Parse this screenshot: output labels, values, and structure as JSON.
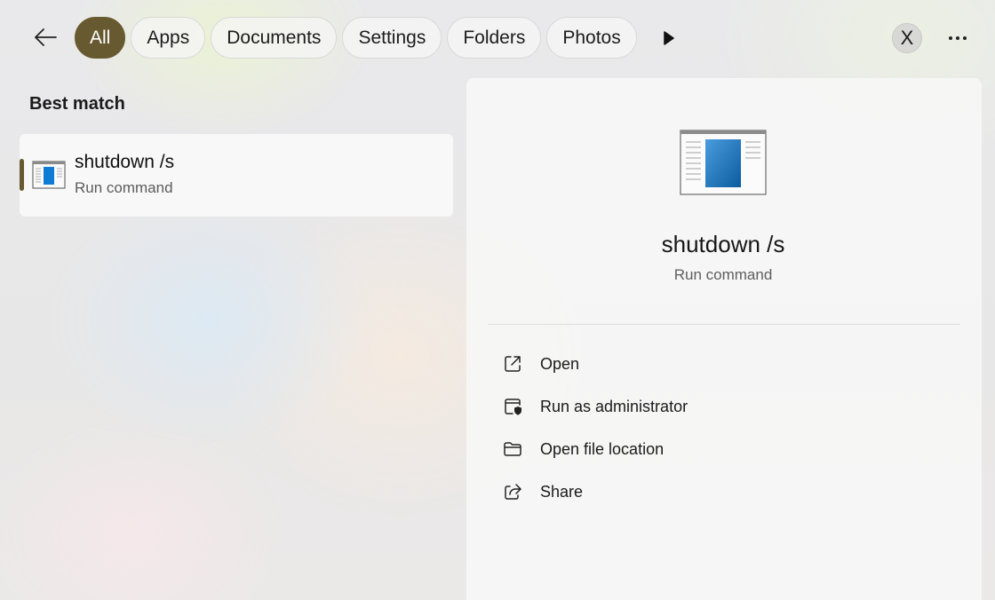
{
  "filters": {
    "items": [
      {
        "label": "All",
        "active": true
      },
      {
        "label": "Apps",
        "active": false
      },
      {
        "label": "Documents",
        "active": false
      },
      {
        "label": "Settings",
        "active": false
      },
      {
        "label": "Folders",
        "active": false
      },
      {
        "label": "Photos",
        "active": false
      }
    ]
  },
  "user": {
    "initial": "X"
  },
  "results": {
    "section_title": "Best match",
    "best_match": {
      "name": "shutdown /s",
      "kind": "Run command"
    }
  },
  "detail": {
    "name": "shutdown /s",
    "kind": "Run command",
    "actions": [
      {
        "label": "Open",
        "icon": "open-external-icon"
      },
      {
        "label": "Run as administrator",
        "icon": "run-as-admin-shield-icon"
      },
      {
        "label": "Open file location",
        "icon": "folder-icon"
      },
      {
        "label": "Share",
        "icon": "share-icon"
      }
    ]
  },
  "colors": {
    "accent": "#685a30",
    "chip_active_text": "#ffffff",
    "app_icon_blue": "#0f7bd4"
  }
}
